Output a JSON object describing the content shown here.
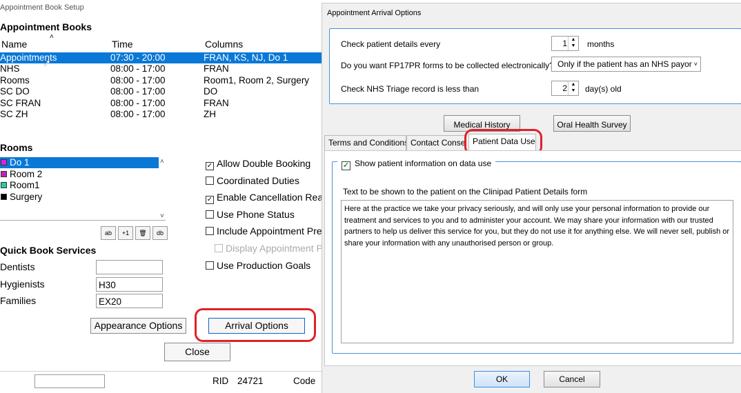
{
  "setup": {
    "window_title": "Appointment Book Setup",
    "books_heading": "Appointment Books",
    "headers": {
      "name": "Name",
      "time": "Time",
      "columns": "Columns"
    },
    "books": [
      {
        "name": "Appointments",
        "time": "07:30 - 20:00",
        "columns": "FRAN, KS, NJ, Do 1",
        "selected": true
      },
      {
        "name": "NHS",
        "time": "08:00 - 17:00",
        "columns": "FRAN"
      },
      {
        "name": "Rooms",
        "time": "08:00 - 17:00",
        "columns": "Room1, Room 2, Surgery"
      },
      {
        "name": "SC DO",
        "time": "08:00 - 17:00",
        "columns": "DO"
      },
      {
        "name": "SC FRAN",
        "time": "08:00 - 17:00",
        "columns": "FRAN"
      },
      {
        "name": "SC ZH",
        "time": "08:00 - 17:00",
        "columns": "ZH"
      }
    ],
    "rooms_heading": "Rooms",
    "rooms": [
      {
        "name": "Do 1",
        "color": "#e020e0",
        "selected": true
      },
      {
        "name": "Room 2",
        "color": "#c020c0"
      },
      {
        "name": "Room1",
        "color": "#20d0a0"
      },
      {
        "name": "Surgery",
        "color": "#000000"
      }
    ],
    "room_buttons": [
      "ab",
      "+1",
      "🗑",
      "db"
    ],
    "options": [
      {
        "label": "Allow Double Booking",
        "checked": true
      },
      {
        "label": "Coordinated Duties",
        "checked": false
      },
      {
        "label": "Enable Cancellation Reas",
        "checked": true
      },
      {
        "label": "Use Phone Status",
        "checked": false
      },
      {
        "label": "Include Appointment Pref",
        "checked": false
      },
      {
        "label": "Display Appointment P",
        "checked": false,
        "disabled": true
      },
      {
        "label": "Use Production Goals",
        "checked": false
      }
    ],
    "quick_book_heading": "Quick Book Services",
    "quick_book": [
      {
        "label": "Dentists",
        "value": ""
      },
      {
        "label": "Hygienists",
        "value": "H30"
      },
      {
        "label": "Families",
        "value": "EX20"
      }
    ],
    "appearance_button": "Appearance Options",
    "arrival_button": "Arrival Options",
    "close_button": "Close",
    "footer": {
      "rid_label": "RID",
      "rid_value": "24721",
      "code_label": "Code"
    }
  },
  "arrival": {
    "window_title": "Appointment Arrival Options",
    "check_details_label": "Check patient details every",
    "check_details_value": "1",
    "check_details_unit": "months",
    "fp17pr_label": "Do you want FP17PR forms to be collected electronically?",
    "fp17pr_value": "Only if the patient has an NHS payor",
    "triage_label": "Check NHS Triage record is less than",
    "triage_value": "2",
    "triage_unit": "day(s) old",
    "medical_history_button": "Medical History",
    "oral_health_button": "Oral Health Survey",
    "tabs": [
      "Terms and Conditions",
      "Contact Consen",
      "Patient Data Use"
    ],
    "active_tab": "Patient Data Use",
    "show_info_label": "Show patient information on data use",
    "show_info_checked": true,
    "text_label": "Text to be shown to the patient on the Clinipad Patient Details form",
    "text_value": "Here at the practice we take your privacy seriously, and will only use your personal information to provide our treatment and services to you and to administer your account. We may share your information with our trusted partners to help us deliver this service for you, but they do not use it for anything else.  We will never sell, publish or share your information with any unauthorised person or group.",
    "ok_button": "OK",
    "cancel_button": "Cancel"
  }
}
